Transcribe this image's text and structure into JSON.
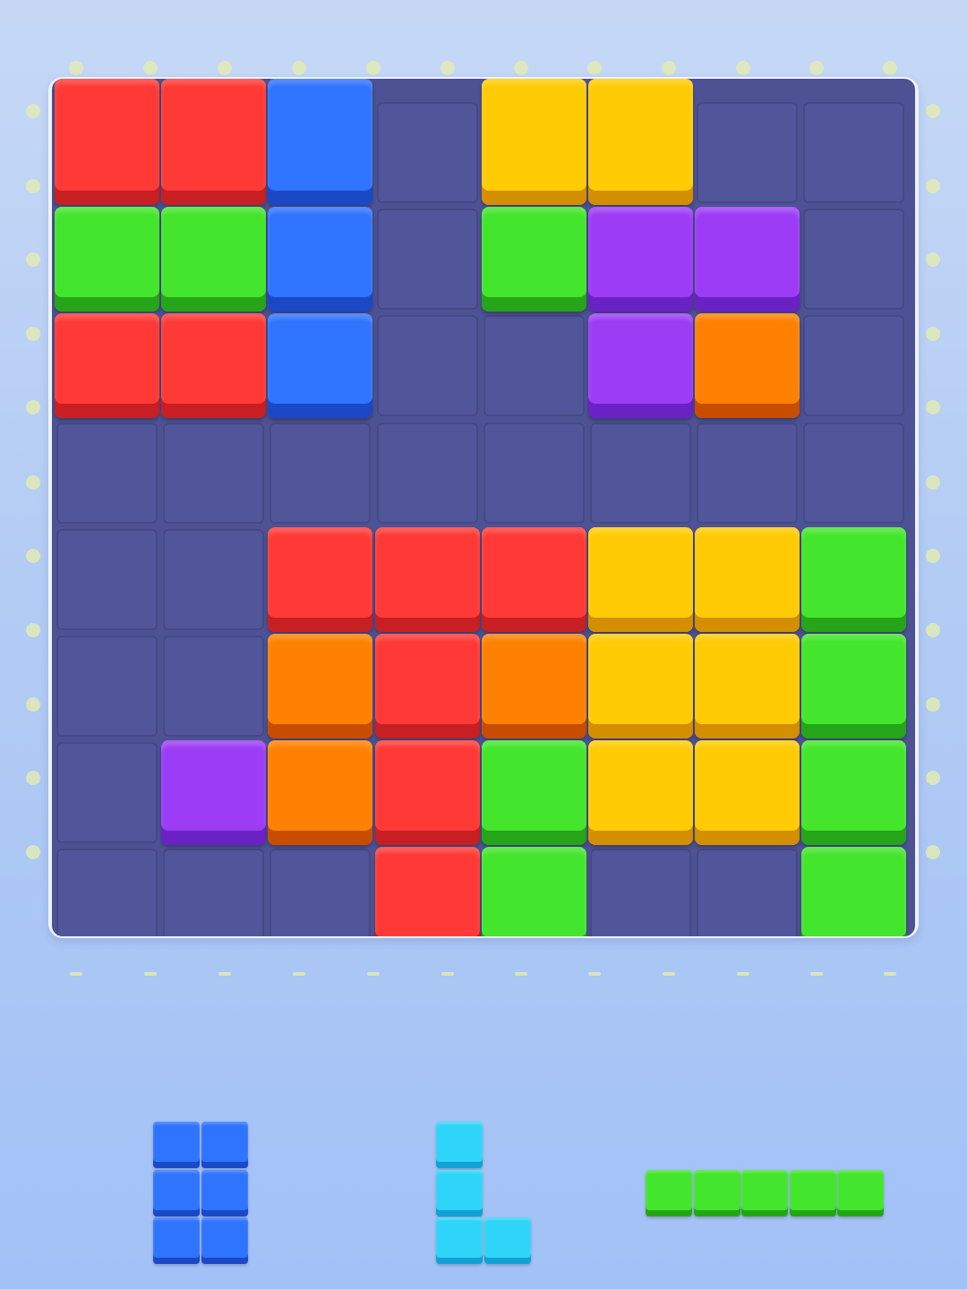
{
  "palette": {
    "R": {
      "name": "red",
      "top": "#ff3a36",
      "side": "#c81f22"
    },
    "B": {
      "name": "blue",
      "top": "#2f74ff",
      "side": "#1b48c4"
    },
    "Y": {
      "name": "yellow",
      "top": "#ffcb05",
      "side": "#d48f00"
    },
    "G": {
      "name": "green",
      "top": "#44e52d",
      "side": "#26a51a"
    },
    "P": {
      "name": "purple",
      "top": "#9c3df5",
      "side": "#6a22c4"
    },
    "O": {
      "name": "orange",
      "top": "#ff8104",
      "side": "#c94d00"
    },
    "C": {
      "name": "cyan",
      "top": "#2fd4f9",
      "side": "#13a1d3"
    }
  },
  "board": {
    "rows": 8,
    "cols": 8,
    "cells": [
      [
        "R",
        "R",
        "B",
        ".",
        "Y",
        "Y",
        ".",
        "."
      ],
      [
        "G",
        "G",
        "B",
        ".",
        "G",
        "P",
        "P",
        "."
      ],
      [
        "R",
        "R",
        "B",
        ".",
        ".",
        "P",
        "O",
        "."
      ],
      [
        ".",
        ".",
        ".",
        ".",
        ".",
        ".",
        ".",
        "."
      ],
      [
        ".",
        ".",
        "R",
        "R",
        "R",
        "Y",
        "Y",
        "G"
      ],
      [
        ".",
        ".",
        "O",
        "R",
        "O",
        "Y",
        "Y",
        "G"
      ],
      [
        ".",
        "P",
        "O",
        "R",
        "G",
        "Y",
        "Y",
        "G"
      ],
      [
        ".",
        ".",
        ".",
        "R",
        "G",
        ".",
        ".",
        "G"
      ]
    ]
  },
  "tray": {
    "pieces": [
      {
        "id": "piece-blue-2x3",
        "color": "B",
        "shape": [
          [
            1,
            1
          ],
          [
            1,
            1
          ],
          [
            1,
            1
          ]
        ]
      },
      {
        "id": "piece-cyan-l",
        "color": "C",
        "shape": [
          [
            1,
            0
          ],
          [
            1,
            0
          ],
          [
            1,
            1
          ]
        ]
      },
      {
        "id": "piece-green-line5",
        "color": "G",
        "shape": [
          [
            1,
            1,
            1,
            1,
            1
          ]
        ]
      }
    ]
  }
}
